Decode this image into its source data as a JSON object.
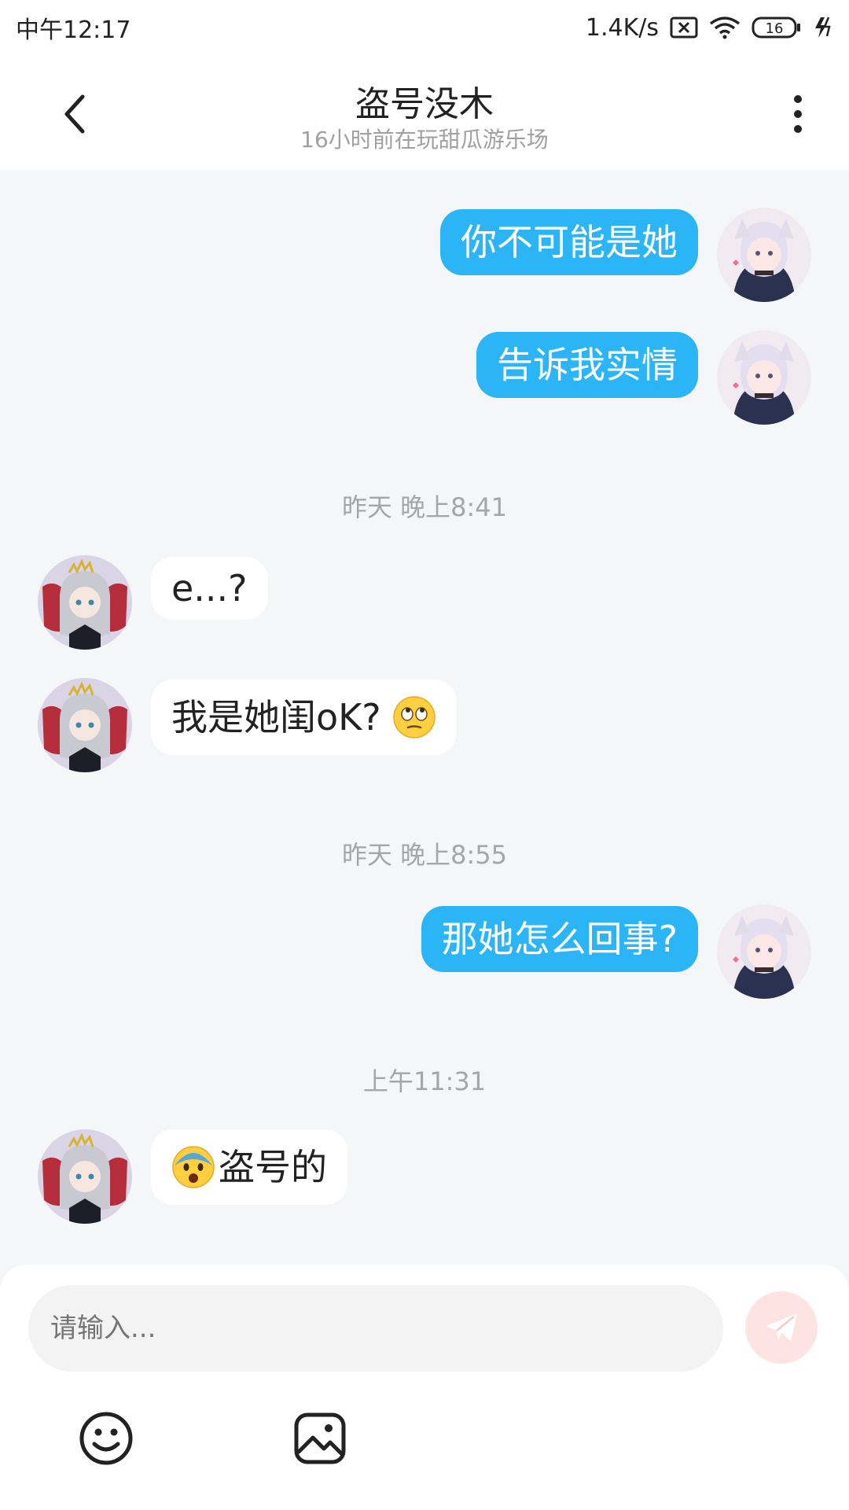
{
  "status_bar": {
    "time": "中午12:17",
    "network_speed": "1.4K/s",
    "battery": "16",
    "icons": [
      "sim-x-icon",
      "wifi-icon",
      "battery-icon",
      "charging-icon"
    ]
  },
  "header": {
    "title": "盗号没木",
    "subtitle": "16小时前在玩甜瓜游乐场",
    "back_icon": "back-arrow-icon",
    "more_icon": "more-vertical-icon"
  },
  "chat": {
    "messages": [
      {
        "type": "outgoing",
        "text": "你不可能是她"
      },
      {
        "type": "outgoing",
        "text": "告诉我实情"
      },
      {
        "type": "timestamp",
        "text": "昨天 晚上8:41"
      },
      {
        "type": "incoming",
        "text": "e...?"
      },
      {
        "type": "incoming",
        "text": "我是她闺oK?",
        "emoji": "eye-roll-emoji"
      },
      {
        "type": "timestamp",
        "text": "昨天 晚上8:55"
      },
      {
        "type": "outgoing",
        "text": "那她怎么回事?"
      },
      {
        "type": "timestamp",
        "text": "上午11:31"
      },
      {
        "type": "incoming",
        "text": "盗号的",
        "emoji": "anguished-face-emoji"
      }
    ]
  },
  "composer": {
    "placeholder": "请输入...",
    "send_icon": "send-icon",
    "emoji_icon": "smiley-icon",
    "image_icon": "image-icon"
  },
  "colors": {
    "outgoing_bubble": "#2bb5f7",
    "incoming_bubble": "#ffffff",
    "background": "#f5f6f8",
    "send_button": "#fde4e3"
  }
}
